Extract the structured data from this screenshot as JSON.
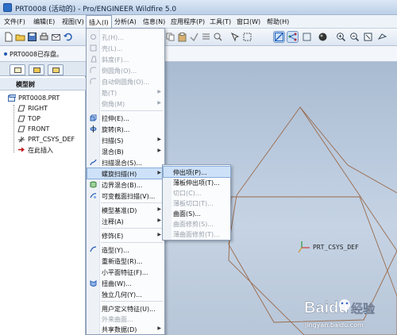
{
  "window": {
    "title": "PRT0008 (活动的) - Pro/ENGINEER Wildfire 5.0"
  },
  "menubar": [
    {
      "label": "文件(F)"
    },
    {
      "label": "编辑(E)"
    },
    {
      "label": "视图(V)"
    },
    {
      "label": "插入(I)"
    },
    {
      "label": "分析(A)"
    },
    {
      "label": "信息(N)"
    },
    {
      "label": "应用程序(P)"
    },
    {
      "label": "工具(T)"
    },
    {
      "label": "窗口(W)"
    },
    {
      "label": "帮助(H)"
    }
  ],
  "status": {
    "message": "PRT0008已存盘。"
  },
  "model_tree": {
    "header": "模型树",
    "root": "PRT0008.PRT",
    "items": [
      {
        "label": "RIGHT",
        "icon": "datum-plane-icon"
      },
      {
        "label": "TOP",
        "icon": "datum-plane-icon"
      },
      {
        "label": "FRONT",
        "icon": "datum-plane-icon"
      },
      {
        "label": "PRT_CSYS_DEF",
        "icon": "csys-icon"
      },
      {
        "label": "在此插入",
        "icon": "insert-here-arrow-icon"
      }
    ]
  },
  "insert_menu": {
    "items": [
      {
        "label": "孔(H)...",
        "disabled": true,
        "icon": "hole-icon"
      },
      {
        "label": "壳(L)...",
        "disabled": true,
        "icon": "shell-icon"
      },
      {
        "label": "斜度(F)...",
        "disabled": true,
        "icon": "draft-icon"
      },
      {
        "label": "倒圆角(O)...",
        "disabled": true,
        "icon": "round-icon"
      },
      {
        "label": "自动倒圆角(O)...",
        "disabled": true,
        "icon": "auto-round-icon"
      },
      {
        "label": "筋(T)",
        "disabled": true,
        "submenu": true
      },
      {
        "label": "倒角(M)",
        "disabled": true,
        "submenu": true
      },
      {
        "label": "拉伸(E)...",
        "disabled": false,
        "icon": "extrude-icon"
      },
      {
        "label": "旋转(R)...",
        "disabled": false,
        "icon": "revolve-icon"
      },
      {
        "label": "扫描(S)",
        "disabled": false,
        "submenu": true
      },
      {
        "label": "混合(B)",
        "disabled": false,
        "submenu": true
      },
      {
        "label": "扫描混合(S)...",
        "disabled": false,
        "icon": "swept-blend-icon"
      },
      {
        "label": "螺旋扫描(H)",
        "disabled": false,
        "submenu": true,
        "highlighted": true
      },
      {
        "label": "边界混合(B)...",
        "disabled": false,
        "icon": "boundary-blend-icon"
      },
      {
        "label": "可变截面扫描(V)...",
        "disabled": false,
        "icon": "variable-section-sweep-icon"
      },
      {
        "label": "模型基准(D)",
        "disabled": false,
        "submenu": true
      },
      {
        "label": "注释(A)",
        "disabled": false,
        "submenu": true
      },
      {
        "label": "修饰(E)",
        "disabled": false,
        "submenu": true
      },
      {
        "label": "造型(Y)...",
        "disabled": false,
        "icon": "style-icon"
      },
      {
        "label": "重新造型(R)...",
        "disabled": false
      },
      {
        "label": "小平面特征(F)...",
        "disabled": false
      },
      {
        "label": "扭曲(W)...",
        "disabled": false,
        "icon": "warp-icon"
      },
      {
        "label": "独立几何(Y)...",
        "disabled": false
      },
      {
        "label": "用户定义特征(U)...",
        "disabled": false
      },
      {
        "label": "共享数据(D)",
        "disabled": false,
        "submenu": true
      }
    ],
    "partial_label": "外来曲面..."
  },
  "helical_submenu": {
    "items": [
      {
        "label": "伸出项(P)...",
        "disabled": false,
        "highlighted": true
      },
      {
        "label": "薄板伸出项(T)...",
        "disabled": false
      },
      {
        "label": "切口(C)...",
        "disabled": true
      },
      {
        "label": "薄板切口(T)...",
        "disabled": true
      },
      {
        "label": "曲面(S)...",
        "disabled": false
      },
      {
        "label": "曲面修剪(S)...",
        "disabled": true
      },
      {
        "label": "薄曲面修剪(T)...",
        "disabled": true
      }
    ]
  },
  "viewport": {
    "csys_label": "PRT_CSYS_DEF"
  },
  "watermark": {
    "brand": "Baidu经验",
    "url": "jingyan.baidu.com"
  },
  "colors": {
    "geometry_line": "#9a6a4a",
    "csys_x": "#d23a3a",
    "csys_y": "#2a9a3a",
    "highlight": "#cde1f8"
  }
}
